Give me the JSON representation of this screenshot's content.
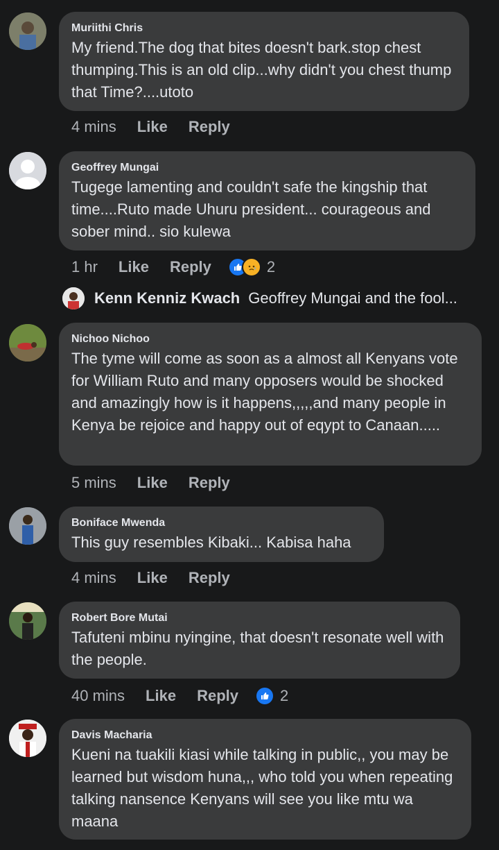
{
  "comments": [
    {
      "author": "Muriithi Chris",
      "text": "My friend.The dog that bites doesn't bark.stop chest thumping.This is an old clip...why didn't you chest thump that Time?....utoto",
      "time": "4 mins",
      "like": "Like",
      "reply": "Reply"
    },
    {
      "author": "Geoffrey Mungai",
      "text": "Tugege lamenting and couldn't safe the kingship that time....Ruto made Uhuru president... courageous and sober mind.. sio kulewa",
      "time": "1 hr",
      "like": "Like",
      "reply": "Reply",
      "reaction_count": "2",
      "reactions": [
        "like-icon",
        "sad-icon"
      ]
    },
    {
      "author": "Nichoo Nichoo",
      "text": "The tyme will come as soon as a almost all Kenyans vote for William Ruto and many opposers would be shocked and amazingly how is it happens,,,,,and many people in Kenya be rejoice and happy out of eqypt to Canaan.....",
      "time": "5 mins",
      "like": "Like",
      "reply": "Reply"
    },
    {
      "author": "Boniface Mwenda",
      "text": "This guy resembles Kibaki... Kabisa haha",
      "time": "4 mins",
      "like": "Like",
      "reply": "Reply"
    },
    {
      "author": "Robert Bore Mutai",
      "text": "Tafuteni mbinu nyingine, that doesn't resonate well with the people.",
      "time": "40 mins",
      "like": "Like",
      "reply": "Reply",
      "reaction_count": "2",
      "reactions": [
        "like-icon"
      ]
    },
    {
      "author": "Davis Macharia",
      "text": "Kueni na tuakili kiasi while talking in public,, you may be learned but wisdom huna,,, who told you when repeating talking nansence Kenyans will see you like mtu wa maana"
    }
  ],
  "reply_preview": {
    "author": "Kenn Kenniz Kwach",
    "text": "Geoffrey Mungai and the fool..."
  },
  "colors": {
    "background": "#18191a",
    "bubble": "#3a3b3c",
    "text": "#e4e6eb",
    "muted": "#b0b3b8",
    "like_blue": "#1877f2",
    "sad_yellow": "#f7b125"
  }
}
